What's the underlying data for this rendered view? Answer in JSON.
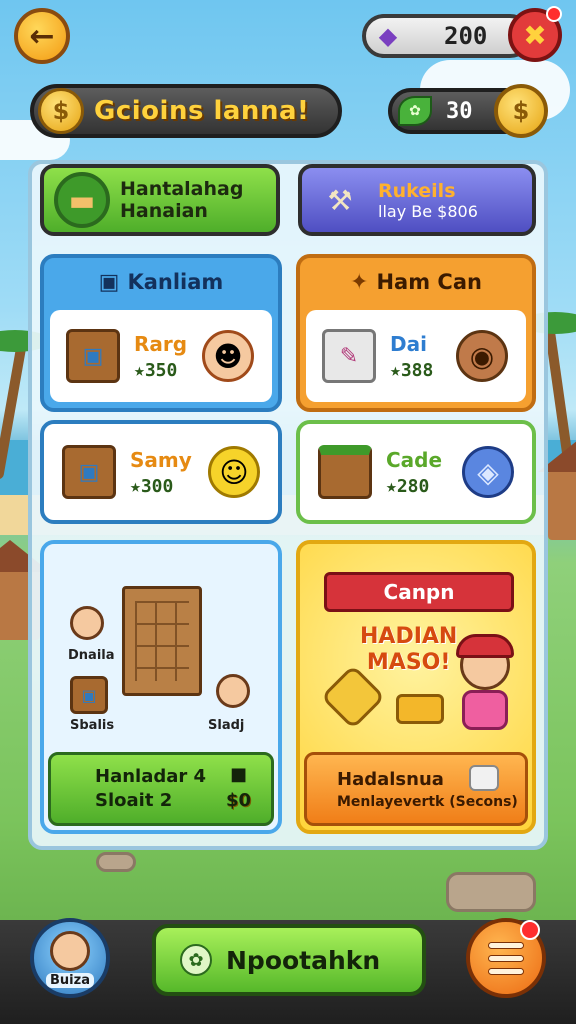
{
  "header": {
    "back_icon": "arrow-left-icon",
    "gems": {
      "icon": "gem-icon",
      "value": "200"
    },
    "heart_icon": "heart-icon",
    "title": "Gcioins lanna!",
    "coin_icon": "coin-icon",
    "leaves": {
      "icon": "leaf-icon",
      "value": "30"
    }
  },
  "top_cards": {
    "left": {
      "line1": "Hantalahag",
      "line2": "Hanaian",
      "icon": "log-icon"
    },
    "right": {
      "line1": "Rukeils",
      "line2": "llay Be $806",
      "icon": "tools-icon"
    }
  },
  "sections": {
    "left": {
      "title": "Kanliam",
      "icon": "crate-icon",
      "items": [
        {
          "name": "Rarg",
          "price": "★350",
          "side_icon": "girl-face-icon"
        },
        {
          "name": "Samy",
          "price": "★300",
          "side_icon": "smiley-icon"
        }
      ]
    },
    "right": {
      "title": "Ham Can",
      "icon": "bone-icon",
      "items": [
        {
          "name": "Dai",
          "price": "★388",
          "side_icon": "bear-icon"
        },
        {
          "name": "Cade",
          "price": "★280",
          "side_icon": "bunny-icon"
        }
      ]
    }
  },
  "big_left": {
    "label_tl": "Dnaila",
    "label_bl": "Sbalis",
    "label_br": "Sladj",
    "footer_line1": "Hanladar 4",
    "footer_line2": "Sloait 2",
    "footer_badge": "$0"
  },
  "big_right": {
    "ribbon": "Canpn",
    "promo_line1": "HADIAN",
    "promo_line2": "MASO!",
    "footer_line1": "Hadalsnua",
    "footer_line2": "Menlayevertk (Secons)"
  },
  "bottom": {
    "avatar_label": "Buiza",
    "main_button": "Npootahkn",
    "menu_icon": "hamburger-menu-icon"
  }
}
